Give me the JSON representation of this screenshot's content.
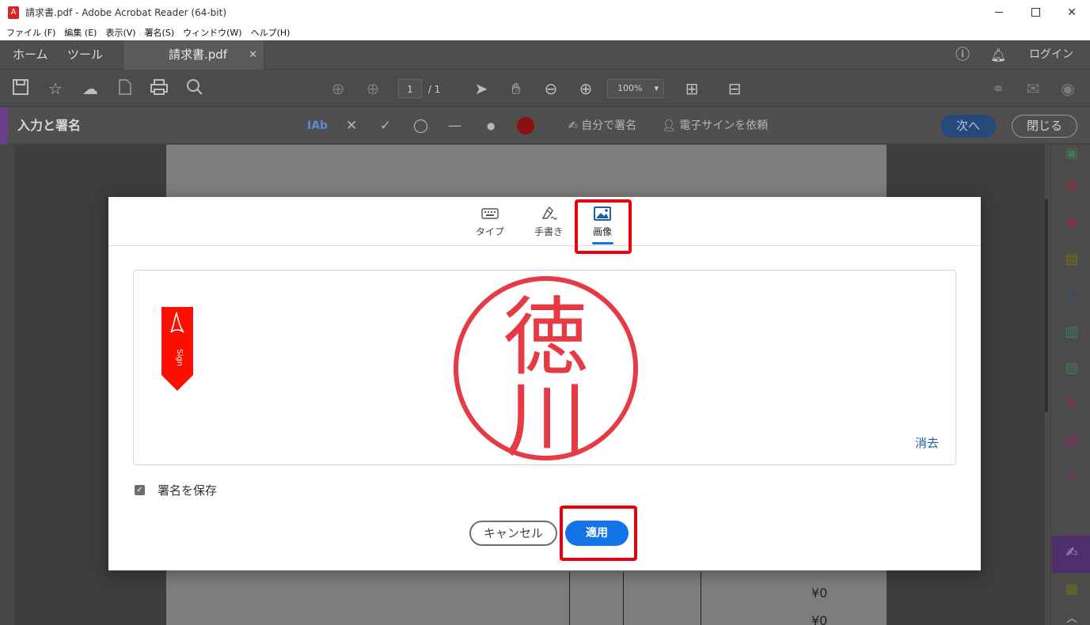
{
  "window": {
    "title": "請求書.pdf - Adobe Acrobat Reader (64-bit)"
  },
  "menubar": [
    "ファイル (F)",
    "編集 (E)",
    "表示(V)",
    "署名(S)",
    "ウィンドウ(W)",
    "ヘルプ(H)"
  ],
  "tabs": {
    "home": "ホーム",
    "tools": "ツール",
    "document": "請求書.pdf",
    "login": "ログイン"
  },
  "toolbar": {
    "page_current": "1",
    "page_total": "/ 1",
    "zoom": "100%"
  },
  "signbar": {
    "heading": "入力と署名",
    "text_tool": "IAb",
    "self_sign": "自分で署名",
    "request_esign": "電子サインを依頼",
    "next": "次へ",
    "close": "閉じる"
  },
  "document": {
    "amounts": [
      "¥0",
      "¥0"
    ]
  },
  "dialog": {
    "tabs": [
      {
        "label": "タイプ",
        "icon": "keyboard-icon"
      },
      {
        "label": "手書き",
        "icon": "pen-icon"
      },
      {
        "label": "画像",
        "icon": "image-icon"
      }
    ],
    "active_tab": "画像",
    "ribbon_text": "Sign",
    "seal_text": "徳川",
    "clear": "消去",
    "save_signature_label": "署名を保存",
    "save_signature_checked": true,
    "cancel": "キャンセル",
    "apply": "適用"
  },
  "colors": {
    "accent_blue": "#1473e6",
    "highlight_red": "#e8000b",
    "seal_red": "#e63a45",
    "acrobat_red": "#fa0f00"
  }
}
